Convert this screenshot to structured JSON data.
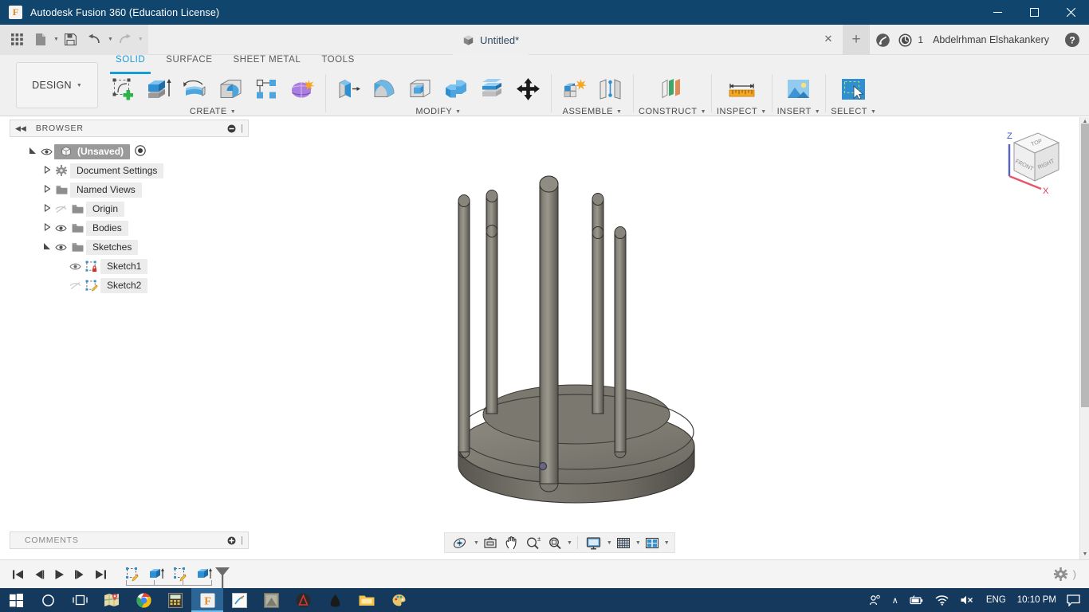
{
  "window": {
    "title": "Autodesk Fusion 360 (Education License)",
    "app_icon": "F",
    "minimize": "—",
    "maximize": "❑",
    "close": "✕",
    "accent_color": "#10466e"
  },
  "quick_access": {
    "items": [
      {
        "name": "app-grid-icon",
        "label": "Grid"
      },
      {
        "name": "new-file-icon",
        "label": "New"
      },
      {
        "name": "save-icon",
        "label": "Save"
      },
      {
        "name": "undo-icon",
        "label": "Undo"
      },
      {
        "name": "redo-icon",
        "label": "Redo"
      }
    ]
  },
  "document_tab": {
    "label": "Untitled*",
    "close_label": "✕",
    "new_tab_label": "+"
  },
  "account_bar": {
    "job_count": "1",
    "user_name": "Abdelrhman Elshakankery",
    "help_label": "?"
  },
  "ribbon": {
    "design_dropdown": "DESIGN",
    "workspace_tabs": [
      {
        "label": "SOLID",
        "active": true
      },
      {
        "label": "SURFACE",
        "active": false
      },
      {
        "label": "SHEET METAL",
        "active": false
      },
      {
        "label": "TOOLS",
        "active": false
      }
    ],
    "panels": [
      {
        "title": "CREATE",
        "has_dropdown": true,
        "commands": [
          {
            "name": "create-sketch-icon",
            "label": "Create Sketch"
          },
          {
            "name": "extrude-icon",
            "label": "Extrude"
          },
          {
            "name": "revolve-icon",
            "label": "Revolve"
          },
          {
            "name": "sweep-icon",
            "label": "Sweep"
          },
          {
            "name": "pattern-icon",
            "label": "Rectangular Pattern"
          },
          {
            "name": "form-icon",
            "label": "Create Form"
          }
        ]
      },
      {
        "title": "MODIFY",
        "has_dropdown": true,
        "commands": [
          {
            "name": "press-pull-icon",
            "label": "Press Pull"
          },
          {
            "name": "fillet-icon",
            "label": "Fillet"
          },
          {
            "name": "shell-icon",
            "label": "Shell"
          },
          {
            "name": "combine-icon",
            "label": "Combine"
          },
          {
            "name": "split-face-icon",
            "label": "Split Face"
          },
          {
            "name": "move-copy-icon",
            "label": "Move/Copy"
          }
        ]
      },
      {
        "title": "ASSEMBLE",
        "has_dropdown": true,
        "commands": [
          {
            "name": "new-component-icon",
            "label": "New Component"
          },
          {
            "name": "joint-icon",
            "label": "Joint"
          }
        ]
      },
      {
        "title": "CONSTRUCT",
        "has_dropdown": true,
        "commands": [
          {
            "name": "construct-plane-icon",
            "label": "Offset Plane"
          }
        ]
      },
      {
        "title": "INSPECT",
        "has_dropdown": true,
        "commands": [
          {
            "name": "measure-icon",
            "label": "Measure"
          }
        ]
      },
      {
        "title": "INSERT",
        "has_dropdown": true,
        "commands": [
          {
            "name": "insert-image-icon",
            "label": "Insert Image"
          }
        ]
      },
      {
        "title": "SELECT",
        "has_dropdown": true,
        "commands": [
          {
            "name": "select-icon",
            "label": "Select"
          }
        ]
      }
    ]
  },
  "browser": {
    "title": "BROWSER",
    "collapse_icon": "◀◀",
    "minimize_icon": "⊖",
    "tree": [
      {
        "label": "(Unsaved)",
        "indent": 0,
        "expander": "open",
        "visibility": "visible",
        "icon": "component-icon",
        "selected": true,
        "has_radio": true
      },
      {
        "label": "Document Settings",
        "indent": 1,
        "expander": "closed",
        "visibility": "none",
        "icon": "gear-icon",
        "selected": false,
        "has_radio": false
      },
      {
        "label": "Named Views",
        "indent": 1,
        "expander": "closed",
        "visibility": "none",
        "icon": "folder-icon",
        "selected": false,
        "has_radio": false
      },
      {
        "label": "Origin",
        "indent": 1,
        "expander": "closed",
        "visibility": "hidden",
        "icon": "folder-icon",
        "selected": false,
        "has_radio": false
      },
      {
        "label": "Bodies",
        "indent": 1,
        "expander": "closed",
        "visibility": "visible",
        "icon": "folder-icon",
        "selected": false,
        "has_radio": false
      },
      {
        "label": "Sketches",
        "indent": 1,
        "expander": "open",
        "visibility": "visible",
        "icon": "folder-icon",
        "selected": false,
        "has_radio": false
      },
      {
        "label": "Sketch1",
        "indent": 2,
        "expander": "none",
        "visibility": "visible",
        "icon": "sketch-locked-icon",
        "selected": false,
        "has_radio": false
      },
      {
        "label": "Sketch2",
        "indent": 2,
        "expander": "none",
        "visibility": "hidden",
        "icon": "sketch-edit-icon",
        "selected": false,
        "has_radio": false
      }
    ]
  },
  "comments": {
    "title": "COMMENTS",
    "add_icon": "⊕"
  },
  "canvas": {
    "background": "#ffffff",
    "model_description": "Circular base plate with six vertical cylindrical rods",
    "model_color": "#7d7a72",
    "viewcube": {
      "faces": [
        "TOP",
        "FRONT",
        "RIGHT"
      ],
      "axes": [
        {
          "label": "Z",
          "color": "#4455cc"
        },
        {
          "label": "X",
          "color": "#e33a4e"
        }
      ]
    }
  },
  "navigation_bar": {
    "items": [
      {
        "name": "orbit-icon",
        "label": "Orbit",
        "dropdown": true
      },
      {
        "name": "look-at-icon",
        "label": "Look At",
        "dropdown": false
      },
      {
        "name": "pan-icon",
        "label": "Pan",
        "dropdown": false
      },
      {
        "name": "zoom-icon",
        "label": "Zoom",
        "dropdown": false
      },
      {
        "name": "zoom-window-icon",
        "label": "Fit",
        "dropdown": true
      },
      {
        "name": "display-settings-icon",
        "label": "Display Settings",
        "dropdown": true
      },
      {
        "name": "grid-snaps-icon",
        "label": "Grid and Snaps",
        "dropdown": true
      },
      {
        "name": "viewports-icon",
        "label": "Viewports",
        "dropdown": true
      }
    ]
  },
  "timeline": {
    "playback": [
      {
        "name": "timeline-first-icon",
        "label": "Go to beginning"
      },
      {
        "name": "timeline-prev-icon",
        "label": "Step back"
      },
      {
        "name": "timeline-play-icon",
        "label": "Play"
      },
      {
        "name": "timeline-next-icon",
        "label": "Step forward"
      },
      {
        "name": "timeline-last-icon",
        "label": "Go to end"
      }
    ],
    "features": [
      {
        "name": "timeline-sketch-icon",
        "label": "Sketch1"
      },
      {
        "name": "timeline-extrude-icon",
        "label": "Extrude1"
      },
      {
        "name": "timeline-sketch-icon",
        "label": "Sketch2"
      },
      {
        "name": "timeline-extrude-icon",
        "label": "Extrude2"
      }
    ],
    "settings_icon": "gear-icon"
  },
  "taskbar": {
    "items": [
      {
        "name": "start-button",
        "label": "Start",
        "active": false
      },
      {
        "name": "cortana-search",
        "label": "Search",
        "active": false
      },
      {
        "name": "task-view",
        "label": "Task View",
        "active": false
      },
      {
        "name": "taskbar-app-maps",
        "label": "Maps",
        "active": false
      },
      {
        "name": "taskbar-app-chrome",
        "label": "Google Chrome",
        "active": false
      },
      {
        "name": "taskbar-app-calculator",
        "label": "Calculator",
        "active": false
      },
      {
        "name": "taskbar-app-fusion360",
        "label": "Autodesk Fusion 360",
        "active": true
      },
      {
        "name": "taskbar-app-editor",
        "label": "Editor",
        "active": false
      },
      {
        "name": "taskbar-app-archive",
        "label": "Archive",
        "active": false
      },
      {
        "name": "taskbar-app-audacity",
        "label": "Audacity",
        "active": false
      },
      {
        "name": "taskbar-app-inkscape",
        "label": "Inkscape",
        "active": false
      },
      {
        "name": "taskbar-app-explorer",
        "label": "File Explorer",
        "active": false
      },
      {
        "name": "taskbar-app-paint",
        "label": "Paint",
        "active": false
      }
    ],
    "tray": {
      "people_icon": "people-icon",
      "chevron_icon": "∧",
      "battery_icon": "battery-icon",
      "network_icon": "wifi-icon",
      "volume_icon": "volume-muted-icon",
      "language": "ENG",
      "clock": "10:10 PM",
      "action_center_icon": "notification-icon"
    }
  }
}
